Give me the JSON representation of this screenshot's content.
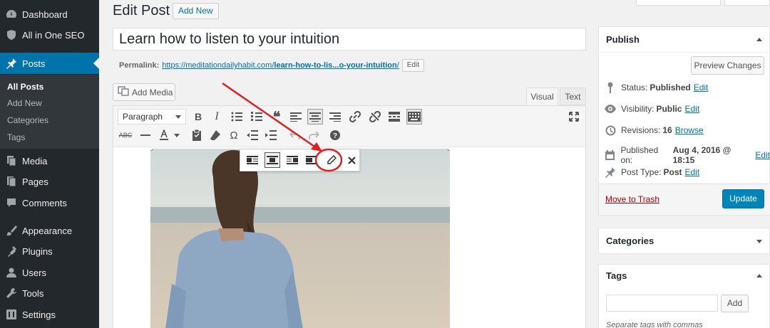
{
  "sidebar": {
    "items": [
      {
        "label": "Dashboard",
        "icon": "dashboard-icon"
      },
      {
        "label": "All in One SEO",
        "icon": "shield-icon"
      },
      {
        "label": "Posts",
        "icon": "pin-icon"
      },
      {
        "label": "Media",
        "icon": "media-icon"
      },
      {
        "label": "Pages",
        "icon": "pages-icon"
      },
      {
        "label": "Comments",
        "icon": "comment-icon"
      },
      {
        "label": "Appearance",
        "icon": "brush-icon"
      },
      {
        "label": "Plugins",
        "icon": "plugin-icon"
      },
      {
        "label": "Users",
        "icon": "user-icon"
      },
      {
        "label": "Tools",
        "icon": "wrench-icon"
      },
      {
        "label": "Settings",
        "icon": "settings-icon"
      }
    ],
    "posts_submenu": [
      "All Posts",
      "Add New",
      "Categories",
      "Tags"
    ],
    "active_item": "Posts",
    "active_color": "#0073aa",
    "bg_color": "#23282d"
  },
  "header": {
    "title": "Edit Post",
    "add_new": "Add New"
  },
  "editor": {
    "post_title": "Learn how to listen to your intuition",
    "permalink_label": "Permalink:",
    "permalink_base": "https://meditationdailyhabit.com/",
    "permalink_slug": "learn-how-to-lis...o-your-intuition",
    "permalink_tail": "/",
    "permalink_edit": "Edit",
    "add_media": "Add Media",
    "tab_visual": "Visual",
    "tab_text": "Text",
    "format_select": "Paragraph"
  },
  "publish": {
    "heading": "Publish",
    "preview_button": "Preview Changes",
    "status_label": "Status:",
    "status_value": "Published",
    "visibility_label": "Visibility:",
    "visibility_value": "Public",
    "revisions_label": "Revisions:",
    "revisions_value": "16",
    "revisions_link": "Browse",
    "published_label": "Published on:",
    "published_value": "Aug 4, 2016 @ 18:15",
    "post_type_label": "Post Type:",
    "post_type_value": "Post",
    "edit_link": "Edit",
    "trash": "Move to Trash",
    "update": "Update",
    "update_color": "#0085ba"
  },
  "categories": {
    "heading": "Categories"
  },
  "tags": {
    "heading": "Tags",
    "add": "Add",
    "hint": "Separate tags with commas"
  },
  "annotation": {
    "color": "#e02020"
  }
}
